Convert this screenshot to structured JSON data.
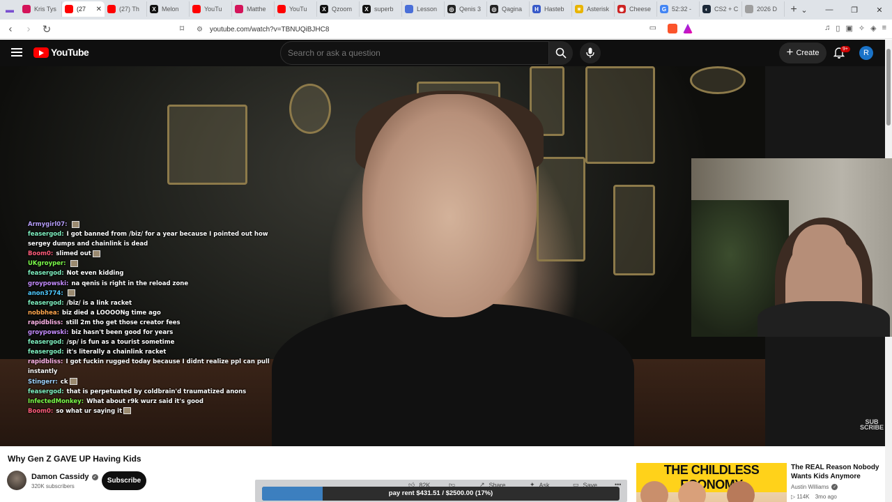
{
  "browser": {
    "tabs": [
      {
        "label": "Kris Tys",
        "color": "#d4145a",
        "glyph": ""
      },
      {
        "label": "(27",
        "color": "#ff0000",
        "glyph": "",
        "active": true
      },
      {
        "label": "(27) Th",
        "color": "#ff0000",
        "glyph": ""
      },
      {
        "label": "Melon",
        "color": "#111111",
        "glyph": "X"
      },
      {
        "label": "YouTu",
        "color": "#ff0000",
        "glyph": ""
      },
      {
        "label": "Matthe",
        "color": "#d4145a",
        "glyph": ""
      },
      {
        "label": "YouTu",
        "color": "#ff0000",
        "glyph": ""
      },
      {
        "label": "Qzoom",
        "color": "#111111",
        "glyph": "X"
      },
      {
        "label": "superb",
        "color": "#111111",
        "glyph": "X"
      },
      {
        "label": "Lesson",
        "color": "#4a6fd8",
        "glyph": ""
      },
      {
        "label": "Qenis 3",
        "color": "#222222",
        "glyph": "◎"
      },
      {
        "label": "Qagina",
        "color": "#222222",
        "glyph": "◎"
      },
      {
        "label": "Hasteb",
        "color": "#3659c9",
        "glyph": "H"
      },
      {
        "label": "Asterisk",
        "color": "#e8b400",
        "glyph": "✶"
      },
      {
        "label": "Cheese",
        "color": "#cc2222",
        "glyph": "◉"
      },
      {
        "label": "52:32 -",
        "color": "#4285f4",
        "glyph": "G"
      },
      {
        "label": "CS2 + C",
        "color": "#1b2838",
        "glyph": "◐"
      },
      {
        "label": "2026 D",
        "color": "#9e9e9e",
        "glyph": ""
      }
    ],
    "url": "youtube.com/watch?v=TBNUQiBJHC8"
  },
  "youtube": {
    "logo": "YouTube",
    "search_placeholder": "Search or ask a question",
    "create_label": "Create",
    "notification_count": "9+",
    "avatar_letter": "R"
  },
  "chat": [
    {
      "user": "Armygirl07:",
      "color": "#b59cf7",
      "msg": "",
      "emote": true
    },
    {
      "user": "feasergod:",
      "color": "#7ff0c0",
      "msg": "I got banned from /biz/ for a year because I pointed out how"
    },
    {
      "user": "",
      "color": "#ffffff",
      "msg": "sergey dumps and chainlink is dead"
    },
    {
      "user": "Boom0:",
      "color": "#ff5c7a",
      "msg": "slimed out",
      "emote": true
    },
    {
      "user": "UKgroyper:",
      "color": "#7cfc4a",
      "msg": "",
      "emote": true
    },
    {
      "user": "feasergod:",
      "color": "#7ff0c0",
      "msg": "Not even kidding"
    },
    {
      "user": "groypowski:",
      "color": "#c58cff",
      "msg": "na qenis is right in the reload zone"
    },
    {
      "user": "anon3774:",
      "color": "#4ec9ff",
      "msg": "",
      "emote": true
    },
    {
      "user": "feasergod:",
      "color": "#7ff0c0",
      "msg": "/biz/ is a link racket"
    },
    {
      "user": "nobbhea:",
      "color": "#ffa64d",
      "msg": "biz died a LOOOONg time ago"
    },
    {
      "user": "rapidbliss:",
      "color": "#ffb3e6",
      "msg": "still 2m tho get those creator fees"
    },
    {
      "user": "groypowski:",
      "color": "#c58cff",
      "msg": "biz hasn't been good for years"
    },
    {
      "user": "feasergod:",
      "color": "#7ff0c0",
      "msg": "/sp/ is fun as a tourist sometime"
    },
    {
      "user": "feasergod:",
      "color": "#7ff0c0",
      "msg": "it's literally a chainlink racket"
    },
    {
      "user": "rapidbliss:",
      "color": "#ffb3e6",
      "msg": "I got fuckin rugged today because I didnt realize ppl can pull"
    },
    {
      "user": "",
      "color": "#ffffff",
      "msg": "instantly"
    },
    {
      "user": "Stingerr:",
      "color": "#9fd3ff",
      "msg": "ck",
      "emote": true
    },
    {
      "user": "feasergod:",
      "color": "#7ff0c0",
      "msg": "that is perpetuated by coldbrain'd traumatized anons"
    },
    {
      "user": "InfectedMonkey:",
      "color": "#7cfc4a",
      "msg": "What about r9k wurz said it's good"
    },
    {
      "user": "Boom0:",
      "color": "#ff5c7a",
      "msg": "so what ur saying it",
      "emote": true
    }
  ],
  "video": {
    "title": "Why Gen Z GAVE UP Having Kids",
    "channel": "Damon Cassidy",
    "subscribers": "320K subscribers",
    "subscribe_label": "Subscribe",
    "likes": "82K",
    "share_label": "Share",
    "ask_label": "Ask",
    "save_label": "Save",
    "sub_logo": "SUB\nSCRIBE"
  },
  "rent_bar": {
    "text": "pay rent $431.51 / $2500.00 (17%)",
    "progress": 0.17,
    "fill_color": "#3c7fbf"
  },
  "recommendation": {
    "thumb_title": "THE CHILDLESS ECONOMY",
    "title": "The REAL Reason Nobody Wants Kids Anymore",
    "channel": "Austin Williams",
    "views": "114K",
    "age": "3mo ago"
  }
}
